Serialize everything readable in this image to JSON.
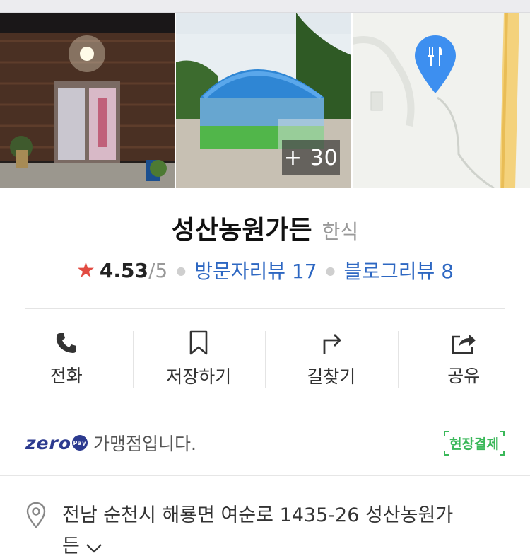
{
  "photos": {
    "more_count": "+ 30",
    "map_pin_icon": "restaurant-pin-icon",
    "pin_color": "#3d8ff0"
  },
  "place": {
    "name": "성산농원가든",
    "category": "한식"
  },
  "rating": {
    "star_icon": "star-icon",
    "score": "4.53",
    "out_of": "/5",
    "visitor_reviews": "방문자리뷰 17",
    "blog_reviews": "블로그리뷰 8",
    "star_color": "#e24b42",
    "link_color": "#2d67c2"
  },
  "actions": [
    {
      "label": "전화",
      "icon": "phone-icon"
    },
    {
      "label": "저장하기",
      "icon": "bookmark-icon"
    },
    {
      "label": "길찾기",
      "icon": "directions-icon"
    },
    {
      "label": "공유",
      "icon": "share-icon"
    }
  ],
  "zeropay": {
    "logo": "zero",
    "logo_badge": "Pay",
    "text": "가맹점입니다.",
    "onsite_label": "현장결제",
    "brand_color": "#2c3a8f",
    "onsite_color": "#3bb85a"
  },
  "address": {
    "icon": "location-pin-icon",
    "line1": "전남 순천시 해룡면 여순로 1435-26 성산농원가",
    "line2": "든"
  }
}
